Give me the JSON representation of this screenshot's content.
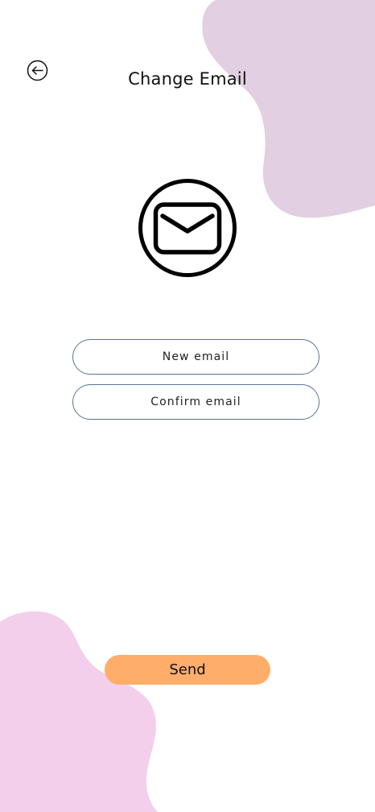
{
  "header": {
    "title": "Change Email",
    "back_icon": "arrow-left-circle-icon"
  },
  "hero": {
    "icon": "envelope-circle-icon"
  },
  "form": {
    "new_email_placeholder": "New email",
    "new_email_value": "",
    "confirm_email_placeholder": "Confirm email",
    "confirm_email_value": ""
  },
  "actions": {
    "send_label": "Send"
  },
  "colors": {
    "blob_top_right": "#e2cfe1",
    "blob_bottom_left": "#f3cfeb",
    "send_button": "#ffad6b",
    "field_border": "#5a7396"
  }
}
